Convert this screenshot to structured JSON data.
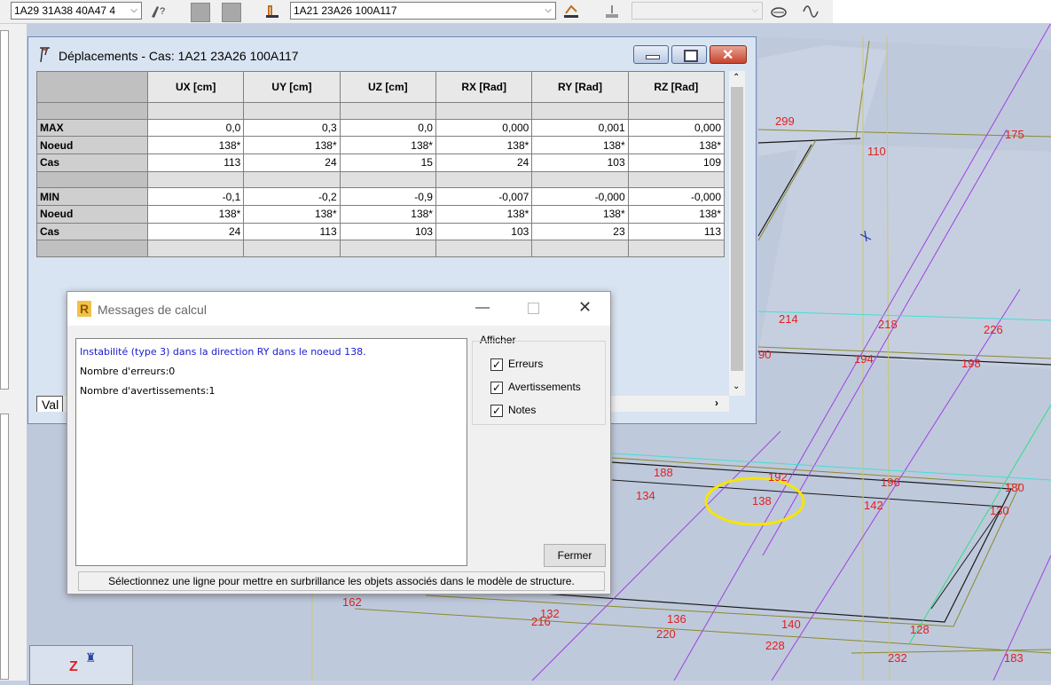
{
  "toolbar": {
    "combo1": "1A29 31A38 40A47 4",
    "combo2": "1A21 23A26 100A117"
  },
  "disp_window": {
    "title": "Déplacements - Cas:  1A21 23A26 100A117",
    "tab_label": "Val",
    "columns": [
      "UX [cm]",
      "UY [cm]",
      "UZ [cm]",
      "RX [Rad]",
      "RY [Rad]",
      "RZ [Rad]"
    ],
    "rows": [
      {
        "label": "",
        "values": [
          "",
          "",
          "",
          "",
          "",
          ""
        ],
        "sep": true
      },
      {
        "label": "MAX",
        "values": [
          "0,0",
          "0,3",
          "0,0",
          "0,000",
          "0,001",
          "0,000"
        ]
      },
      {
        "label": "Noeud",
        "values": [
          "138*",
          "138*",
          "138*",
          "138*",
          "138*",
          "138*"
        ]
      },
      {
        "label": "Cas",
        "values": [
          "113",
          "24",
          "15",
          "24",
          "103",
          "109"
        ]
      },
      {
        "label": "",
        "values": [
          "",
          "",
          "",
          "",
          "",
          ""
        ],
        "sep": true
      },
      {
        "label": "MIN",
        "values": [
          "-0,1",
          "-0,2",
          "-0,9",
          "-0,007",
          "-0,000",
          "-0,000"
        ]
      },
      {
        "label": "Noeud",
        "values": [
          "138*",
          "138*",
          "138*",
          "138*",
          "138*",
          "138*"
        ]
      },
      {
        "label": "Cas",
        "values": [
          "24",
          "113",
          "103",
          "103",
          "23",
          "113"
        ]
      },
      {
        "label": "",
        "values": [
          "",
          "",
          "",
          "",
          "",
          ""
        ],
        "sep": true
      }
    ]
  },
  "msg_dialog": {
    "title": "Messages de calcul",
    "messages": [
      {
        "text": "Instabilité (type 3) dans la direction RY dans le noeud 138.",
        "color": "#1a1ad0"
      },
      {
        "text": "Nombre d'erreurs:0",
        "color": "#000000"
      },
      {
        "text": "Nombre d'avertissements:1",
        "color": "#000000"
      }
    ],
    "afficher_label": "Afficher",
    "checkboxes": [
      "Erreurs",
      "Avertissements",
      "Notes"
    ],
    "close_button": "Fermer",
    "status": "Sélectionnez une ligne pour mettre en surbrillance les objets associés dans le modèle de structure."
  },
  "model_labels": [
    {
      "t": "299"
    },
    {
      "t": "110"
    },
    {
      "t": "175"
    },
    {
      "t": "214"
    },
    {
      "t": "218"
    },
    {
      "t": "226"
    },
    {
      "t": "90"
    },
    {
      "t": "194"
    },
    {
      "t": "198"
    },
    {
      "t": "188"
    },
    {
      "t": "192"
    },
    {
      "t": "134"
    },
    {
      "t": "138"
    },
    {
      "t": "196"
    },
    {
      "t": "142"
    },
    {
      "t": "180"
    },
    {
      "t": "130"
    },
    {
      "t": "162"
    },
    {
      "t": "132"
    },
    {
      "t": "216"
    },
    {
      "t": "136"
    },
    {
      "t": "220"
    },
    {
      "t": "140"
    },
    {
      "t": "228"
    },
    {
      "t": "128"
    },
    {
      "t": "232"
    },
    {
      "t": "183"
    }
  ],
  "axis_label": "Z",
  "colors": {
    "node_label": "#e02020",
    "highlight": "#f5e600"
  }
}
